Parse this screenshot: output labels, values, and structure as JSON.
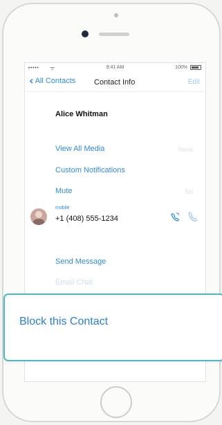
{
  "status_bar": {
    "signal": "•••••",
    "wifi": "ᯤ",
    "time": "9:41 AM",
    "battery": "100%"
  },
  "nav": {
    "back_label": "All Contacts",
    "title": "Contact Info",
    "edit_label": "Edit"
  },
  "contact": {
    "name": "Alice Whitman",
    "phone_label": "mobile",
    "phone_number": "+1 (408) 555-1234"
  },
  "rows": {
    "view_all_media": "View All Media",
    "view_all_media_value": "None",
    "custom_notifications": "Custom Notifications",
    "mute": "Mute",
    "mute_value": "No",
    "send_message": "Send Message",
    "email_chat": "Email Chat"
  },
  "action_sheet": {
    "block_label": "Block this Contact"
  },
  "colors": {
    "accent": "#2e8bdc",
    "sheet_border": "#4db6c8"
  }
}
